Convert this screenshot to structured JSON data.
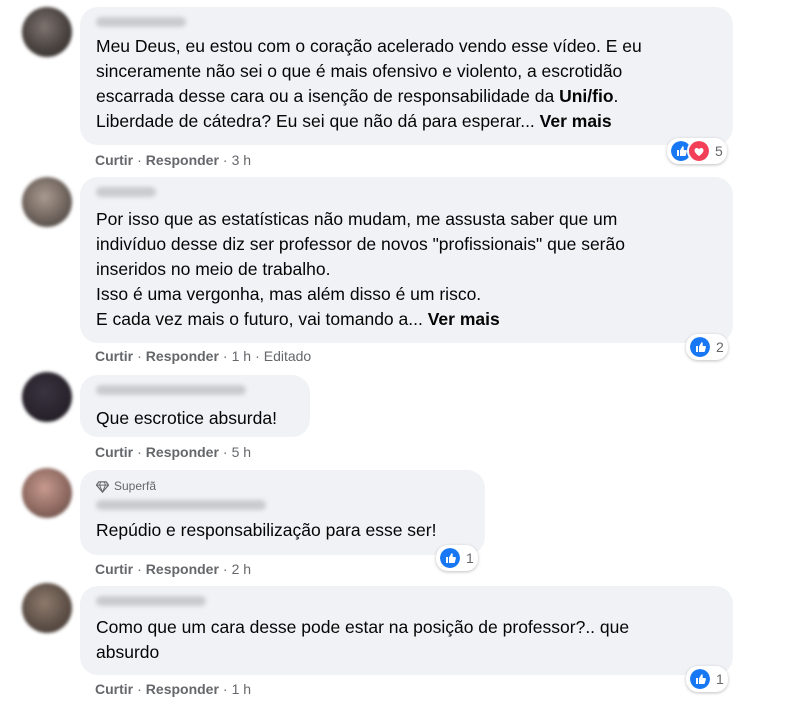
{
  "colors": {
    "like": "#1877f2",
    "love": "#f33e58",
    "bubble": "#f0f2f5",
    "meta": "#65676b"
  },
  "comments": [
    {
      "paragraphs": [
        "Meu Deus, eu estou com o coração acelerado vendo esse vídeo. E eu",
        "sinceramente não sei o que é mais ofensivo e violento, a escrotidão",
        "escarrada desse cara ou a isenção de responsabilidade da ",
        "Liberdade de cátedra? Eu sei que não dá para esperar... "
      ],
      "mention": "Uni/fio",
      "mention_suffix": ".",
      "see_more": "Ver mais",
      "actions": {
        "like": "Curtir",
        "reply": "Responder",
        "time": "3 h"
      },
      "reactions": {
        "icons": [
          "like-icon",
          "love-icon"
        ],
        "count": "5"
      }
    },
    {
      "paragraphs": [
        "Por isso que as estatísticas não mudam, me assusta saber que um",
        "indivíduo desse diz ser professor de novos \"profissionais\" que serão",
        "inseridos no meio de trabalho.",
        "Isso é uma vergonha, mas além disso é um risco.",
        "E cada vez mais o futuro, vai tomando a... "
      ],
      "see_more": "Ver mais",
      "actions": {
        "like": "Curtir",
        "reply": "Responder",
        "time": "1 h",
        "edited": "Editado"
      },
      "reactions": {
        "icons": [
          "like-icon"
        ],
        "count": "2"
      }
    },
    {
      "paragraphs": [
        "Que escrotice absurda!"
      ],
      "actions": {
        "like": "Curtir",
        "reply": "Responder",
        "time": "5 h"
      }
    },
    {
      "badge": {
        "icon": "diamond-icon",
        "label": "Superfã"
      },
      "paragraphs": [
        "Repúdio e responsabilização para esse ser!"
      ],
      "actions": {
        "like": "Curtir",
        "reply": "Responder",
        "time": "2 h"
      },
      "reactions": {
        "icons": [
          "like-icon"
        ],
        "count": "1"
      }
    },
    {
      "paragraphs": [
        "Como que um cara desse pode estar na posição de professor?.. que",
        "absurdo"
      ],
      "actions": {
        "like": "Curtir",
        "reply": "Responder",
        "time": "1 h"
      },
      "reactions": {
        "icons": [
          "like-icon"
        ],
        "count": "1"
      }
    }
  ]
}
